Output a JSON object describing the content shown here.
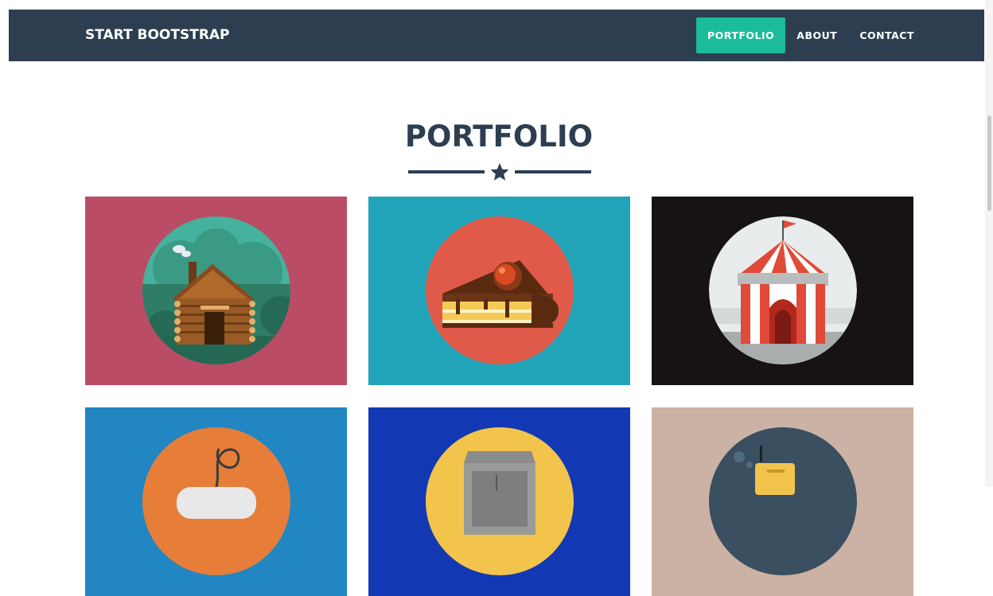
{
  "navbar": {
    "brand": "START BOOTSTRAP",
    "links": [
      {
        "label": "PORTFOLIO",
        "active": true
      },
      {
        "label": "ABOUT",
        "active": false
      },
      {
        "label": "CONTACT",
        "active": false
      }
    ],
    "background": "#2c3e50",
    "accent": "#1abc9c"
  },
  "portfolio": {
    "title": "PORTFOLIO",
    "divider_icon": "star-icon",
    "items": [
      {
        "image": "cabin",
        "background": "#bb4c66"
      },
      {
        "image": "cake",
        "background": "#22a4b8"
      },
      {
        "image": "circus-tent",
        "background": "#171314"
      },
      {
        "image": "game-controller",
        "background": "#2186c2"
      },
      {
        "image": "safe",
        "background": "#1338b4"
      },
      {
        "image": "submarine",
        "background": "#cbb2a4"
      }
    ]
  }
}
